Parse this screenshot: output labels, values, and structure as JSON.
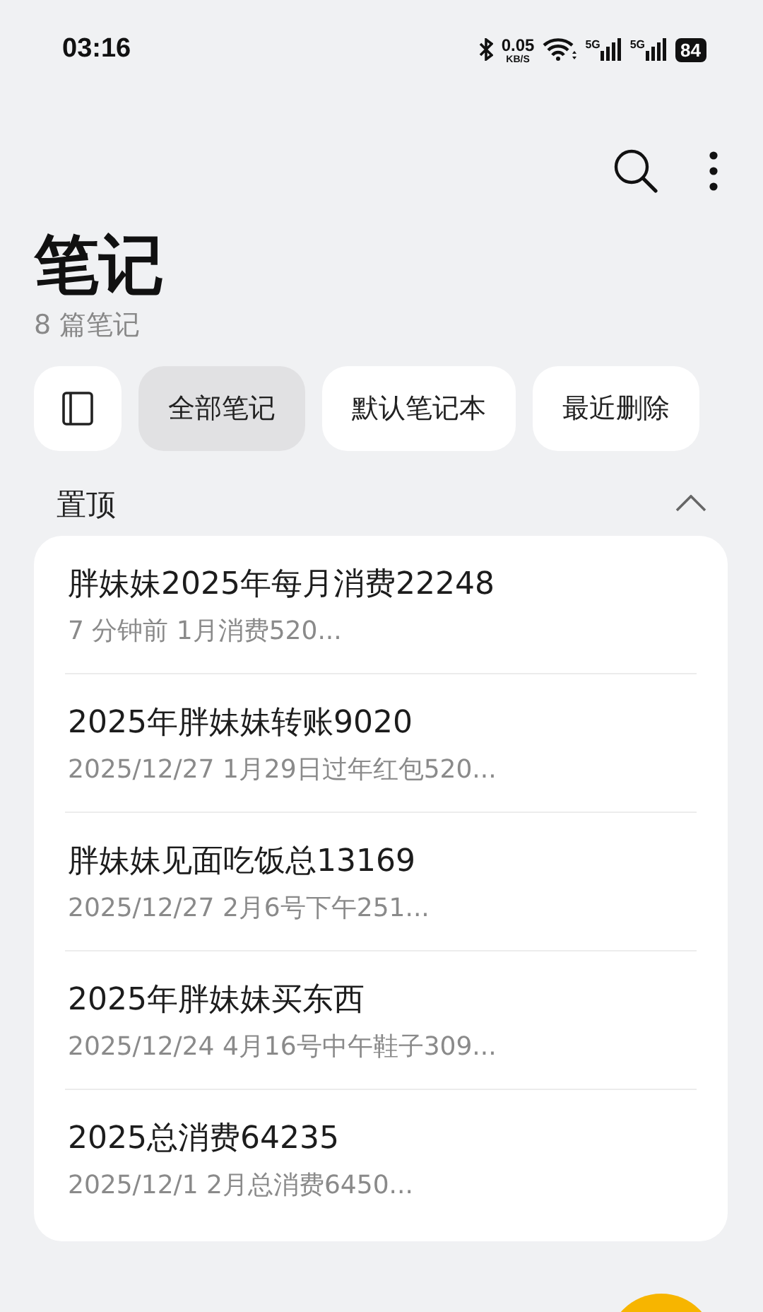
{
  "status_bar": {
    "time": "03:16",
    "net_speed": "0.05",
    "net_unit": "KB/S",
    "networks": [
      "5G",
      "5G"
    ],
    "battery": "84"
  },
  "header": {
    "title": "笔记",
    "count": "8 篇笔记"
  },
  "chips": [
    {
      "kind": "icon",
      "selected": false
    },
    {
      "kind": "text",
      "label": "全部笔记",
      "selected": true
    },
    {
      "kind": "text",
      "label": "默认笔记本",
      "selected": false
    },
    {
      "kind": "text",
      "label": "最近删除",
      "selected": false
    }
  ],
  "section": {
    "title": "置顶",
    "expanded": true
  },
  "notes": [
    {
      "title": "胖妹妹2025年每月消费22248",
      "preview": "7 分钟前 1月消费520..."
    },
    {
      "title": "2025年胖妹妹转账9020",
      "preview": "2025/12/27 1月29日过年红包520..."
    },
    {
      "title": "胖妹妹见面吃饭总13169",
      "preview": "2025/12/27 2月6号下午251..."
    },
    {
      "title": "2025年胖妹妹买东西",
      "preview": "2025/12/24 4月16号中午鞋子309..."
    },
    {
      "title": "2025总消费64235",
      "preview": "2025/12/1 2月总消费6450..."
    }
  ]
}
